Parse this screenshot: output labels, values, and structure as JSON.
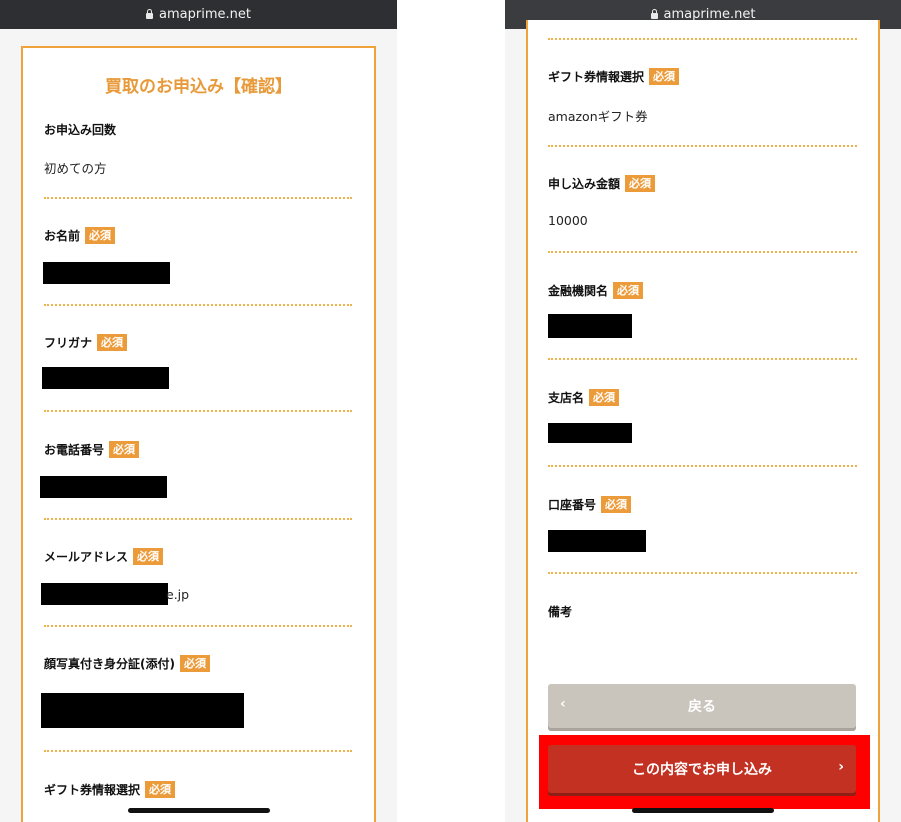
{
  "left_panel": {
    "url": "amaprime.net",
    "title": "買取のお申込み【確認】",
    "badge": "必須",
    "fields": {
      "count": {
        "label": "お申込み回数",
        "value": "初めての方"
      },
      "name": {
        "label": "お名前"
      },
      "furigana": {
        "label": "フリガナ"
      },
      "phone": {
        "label": "お電話番号"
      },
      "email": {
        "label": "メールアドレス",
        "visible_suffix": "e.jp"
      },
      "id_photo": {
        "label": "顔写真付き身分証(添付)"
      },
      "gift": {
        "label": "ギフト券情報選択"
      }
    }
  },
  "right_panel": {
    "url": "amaprime.net",
    "badge": "必須",
    "fields": {
      "gift": {
        "label": "ギフト券情報選択",
        "value": "amazonギフト券"
      },
      "amount": {
        "label": "申し込み金額",
        "value": "10000"
      },
      "bank": {
        "label": "金融機関名"
      },
      "branch": {
        "label": "支店名"
      },
      "account": {
        "label": "口座番号"
      },
      "notes": {
        "label": "備考"
      }
    },
    "back_button": {
      "label": "戻る",
      "icon": "chevron-left-icon"
    },
    "submit_button": {
      "label": "この内容でお申し込み",
      "icon": "chevron-right-icon"
    }
  },
  "colors": {
    "accent": "#f0a33b",
    "submit": "#c23122",
    "back": "#c9c4bc",
    "highlight": "#ff0000"
  }
}
